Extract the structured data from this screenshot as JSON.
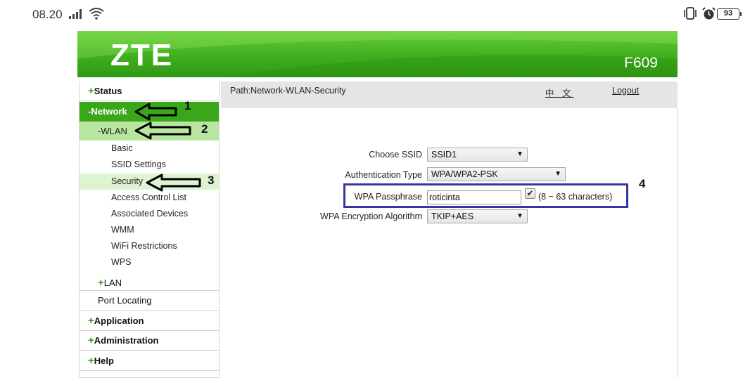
{
  "status_bar": {
    "time": "08.20",
    "battery": "93"
  },
  "header": {
    "logo": "ZTE",
    "model": "F609"
  },
  "topbar": {
    "path": "Path:Network-WLAN-Security",
    "language_link": "中 文",
    "logout_link": "Logout"
  },
  "sidebar": {
    "status": "Status",
    "network": "-Network",
    "wlan": "-WLAN",
    "wlan_items": [
      "Basic",
      "SSID Settings",
      "Security",
      "Access Control List",
      "Associated Devices",
      "WMM",
      "WiFi Restrictions",
      "WPS"
    ],
    "lan": "LAN",
    "port_locating": "Port Locating",
    "application": "Application",
    "administration": "Administration",
    "help": "Help"
  },
  "form": {
    "ssid_label": "Choose SSID",
    "ssid_value": "SSID1",
    "auth_label": "Authentication Type",
    "auth_value": "WPA/WPA2-PSK",
    "passphrase_label": "WPA Passphrase",
    "passphrase_value": "roticinta",
    "passphrase_hint": "(8 ~ 63 characters)",
    "encryption_label": "WPA Encryption Algorithm",
    "encryption_value": "TKIP+AES"
  },
  "annotations": {
    "one": "1",
    "two": "2",
    "three": "3",
    "four": "4"
  },
  "colors": {
    "brand_green": "#3aa71a",
    "highlight_blue": "#3535a5"
  }
}
